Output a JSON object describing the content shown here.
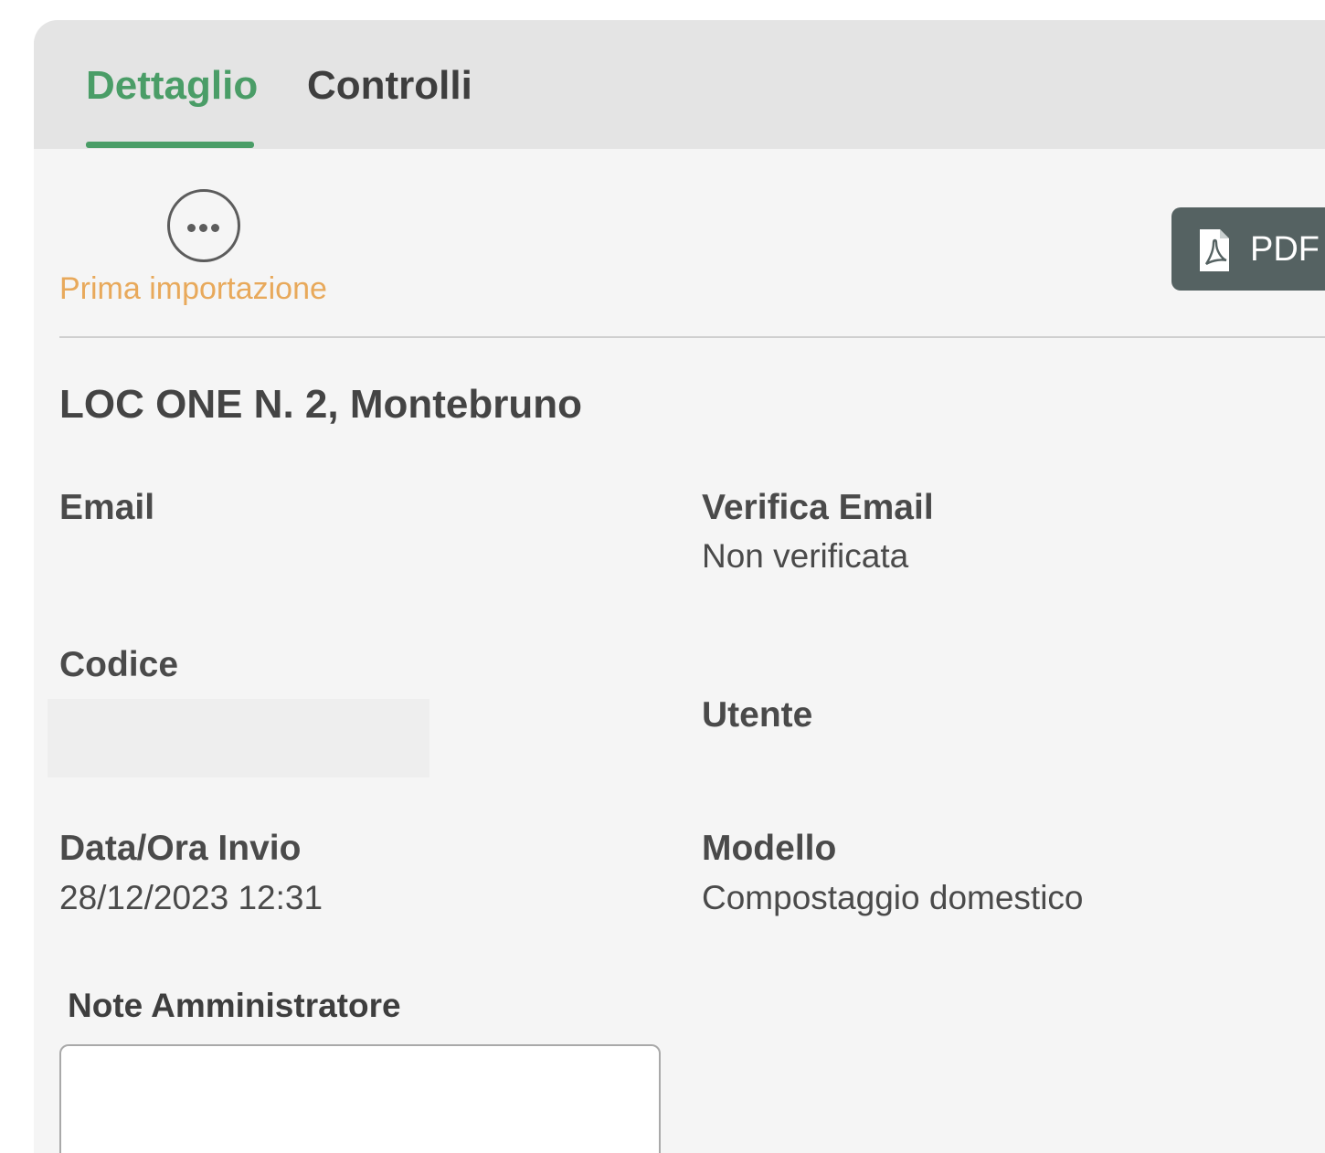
{
  "tabs": {
    "detail_label": "Dettaglio",
    "controls_label": "Controlli"
  },
  "status": {
    "icon": "more-horizontal-icon",
    "label": "Prima importazione"
  },
  "toolbar": {
    "pdf_label": "PDF",
    "pdf_icon": "pdf-file-icon"
  },
  "record": {
    "address": "LOC ONE N. 2, Montebruno",
    "email_label": "Email",
    "email_value": "",
    "verify_email_label": "Verifica Email",
    "verify_email_value": "Non verificata",
    "code_label": "Codice",
    "code_value": "",
    "user_label": "Utente",
    "user_value": "",
    "sent_at_label": "Data/Ora Invio",
    "sent_at_value": "28/12/2023 12:31",
    "model_label": "Modello",
    "model_value": "Compostaggio domestico"
  },
  "notes": {
    "label": "Note Amministratore",
    "value": ""
  },
  "colors": {
    "accent": "#4a9d67",
    "status": "#e8a95b",
    "button": "#556262"
  }
}
